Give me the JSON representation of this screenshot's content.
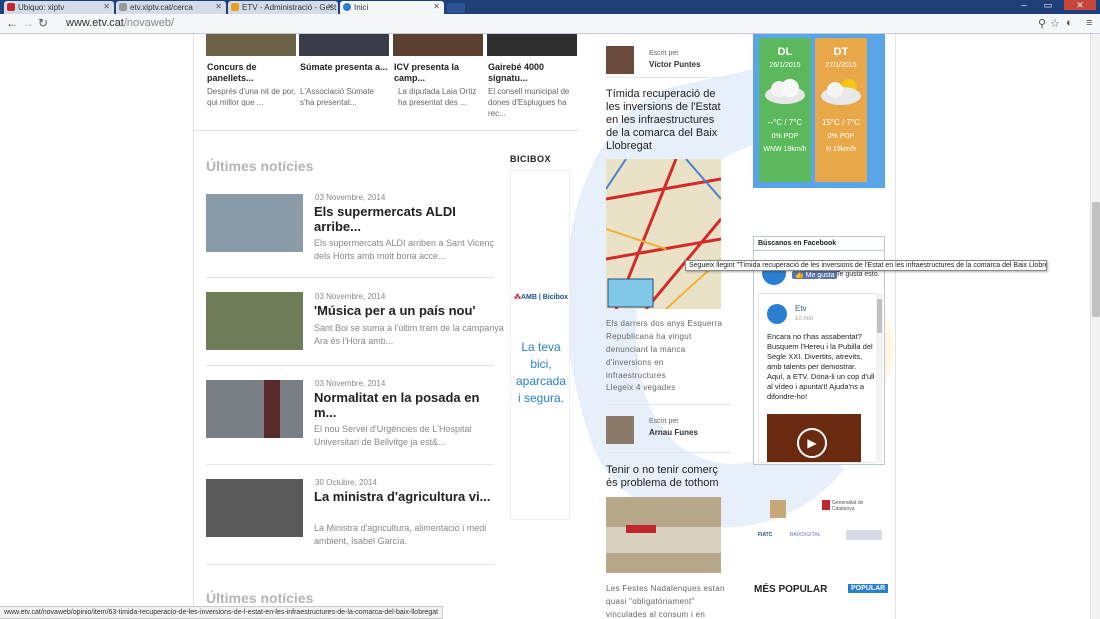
{
  "browser": {
    "tabs": [
      {
        "label": "Ubiquo: xiptv",
        "active": false,
        "favicon_color": "#c0262c"
      },
      {
        "label": "etv.xiptv.cat/cerca",
        "active": false,
        "favicon_color": "#999999"
      },
      {
        "label": "ETV - Administració - Gest",
        "active": false,
        "favicon_color": "#e8a020"
      },
      {
        "label": "Inici",
        "active": true,
        "favicon_color": "#2b7fd0"
      }
    ],
    "url_host": "www.etv.cat",
    "url_path": "/novaweb/"
  },
  "top_articles": [
    {
      "title": "Concurs de panellets...",
      "text": "Després d'una nit de por, qui millor que ..."
    },
    {
      "title": "Súmate presenta a...",
      "text": "L'Associació Súmate s'ha presentat..."
    },
    {
      "title": "ICV presenta la camp...",
      "text": "La diputada Laia Ortiz ha presentat des ..."
    },
    {
      "title": "Gairebé 4000 signatu...",
      "text": "El consell municipal de dones d'Esplugues ha rec..."
    }
  ],
  "latest_news": {
    "heading": "Últimes notícies",
    "items": [
      {
        "date": "03 Novembre, 2014",
        "title": "Els supermercats ALDI arribe...",
        "desc": "Els supermercats ALDI arriben a Sant Vicenç dels Horts amb molt bona acce..."
      },
      {
        "date": "03 Novembre, 2014",
        "title": "'Música per a un país nou'",
        "desc": "Sant Boi se suma a l'últim tram de la campanya Ara és l'Hora amb..."
      },
      {
        "date": "03 Novembre, 2014",
        "title": "Normalitat en la posada en m...",
        "desc": "El nou Servei d'Urgències de L'Hospital Universitari de Bellvitge ja est&..."
      },
      {
        "date": "30 Octubre, 2014",
        "title": "La ministra d'agricultura vi...",
        "desc": "La Ministra d'agricultura, alimentació i medi ambient, Isabel García."
      }
    ],
    "heading2": "Últimes notícies"
  },
  "bicibox": {
    "heading": "BICIBOX",
    "brand_amb": "AMB",
    "brand_sep": " | ",
    "brand_bicibox": "Bicibox",
    "slogan_1": "La teva",
    "slogan_2": "bici,",
    "slogan_3": "aparcada",
    "slogan_4": "i segura."
  },
  "opinion": {
    "written_by": "Escrit per",
    "author1": "Víctor Puntes",
    "article1_title": "Tímida recuperació de les inversions de l'Estat en les infraestructures de la comarca del Baix Llobregat",
    "article1_text": "Els darrers dos anys Esquerra Republicana ha vingut denunciant la manca d'inversions en infraestructures",
    "read_count": "Llegeix 4 vegades",
    "author2": "Arnau Funes",
    "article2_title": "Tenir o no tenir comerç és problema de tothom",
    "article2_text": "Les Festes Nadalenques estan quasi \"obligatòriament\" vinculades al consum i en"
  },
  "weather": {
    "bg_color": "#5aa5e8",
    "days": [
      {
        "day": "DL",
        "date": "26/1/2015",
        "temp": "--°C / 7°C",
        "pop": "0% POP",
        "wind": "WNW 19km/h",
        "color": "#5cb85c"
      },
      {
        "day": "DT",
        "date": "27/1/2015",
        "temp": "15°C / 7°C",
        "pop": "0% POP",
        "wind": "N 19km/h",
        "color": "#e8a84a"
      }
    ]
  },
  "facebook": {
    "heading": "Búscanos en Facebook",
    "like_label": "Me gusta",
    "likes_text": "Te gusta esto.",
    "post_author": "Etv",
    "post_time": "10 min",
    "post_text": "Encara no t'has assabentat? Busquem l'Hereu i la Pubilla del Segle XXI. Divertits, atrevits, amb talents per demostrar. Aquí, a ETV. Dona-li un cop d'ull al vídeo i apunta't! Ajuda'ns a difondre-ho!"
  },
  "tooltip": "Segueix llegint \"Tímida recuperació de les inversions de l'Estat en les infraestructures de la comarca del Baix Llobregat\"",
  "sponsors": [
    "Generalitat de Catalunya",
    "FIATC",
    "BAIXDIGITAL"
  ],
  "popular": {
    "heading": "MÉS POPULAR",
    "tag": "POPULAR"
  },
  "status_url": "www.etv.cat/novaweb/opinio/item/63-timida-recuperacio-de-les-inversions-de-l-estat-en-les-infraestructures-de-la-comarca-del-baix-llobregat"
}
